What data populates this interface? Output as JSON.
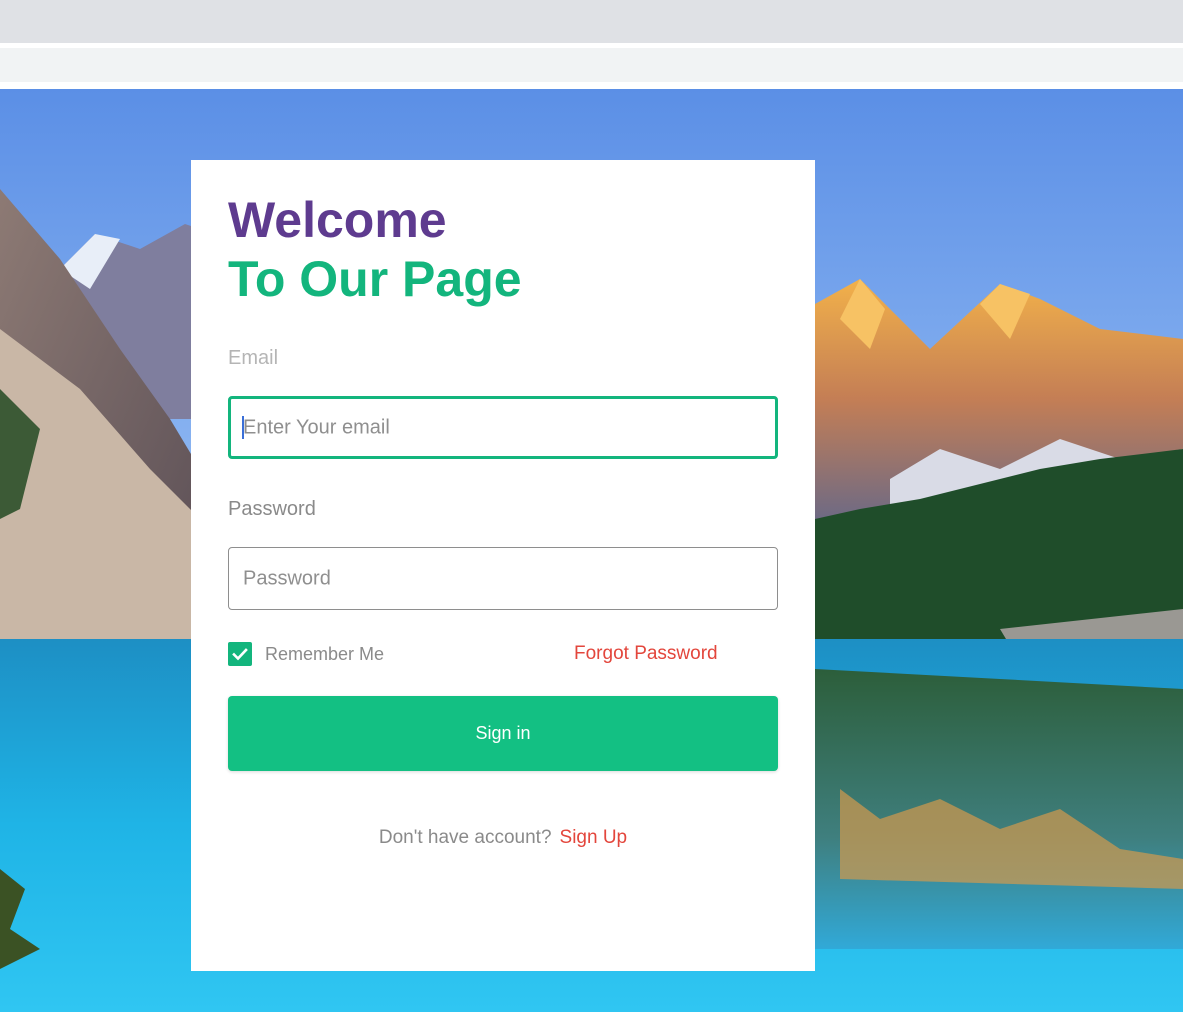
{
  "heading": {
    "line1": "Welcome",
    "line2": "To Our Page"
  },
  "email": {
    "label": "Email",
    "placeholder": "Enter Your email"
  },
  "password": {
    "label": "Password",
    "placeholder": "Password"
  },
  "remember_me": {
    "label": "Remember Me",
    "checked": true
  },
  "forgot_password": "Forgot Password",
  "sign_in": "Sign in",
  "signup": {
    "question": "Don't have account?",
    "link": "Sign Up"
  },
  "colors": {
    "primary": "#13c083",
    "heading_purple": "#5e3b8f",
    "link_red": "#e3463c"
  },
  "icons": {
    "checkbox": "check-icon"
  }
}
